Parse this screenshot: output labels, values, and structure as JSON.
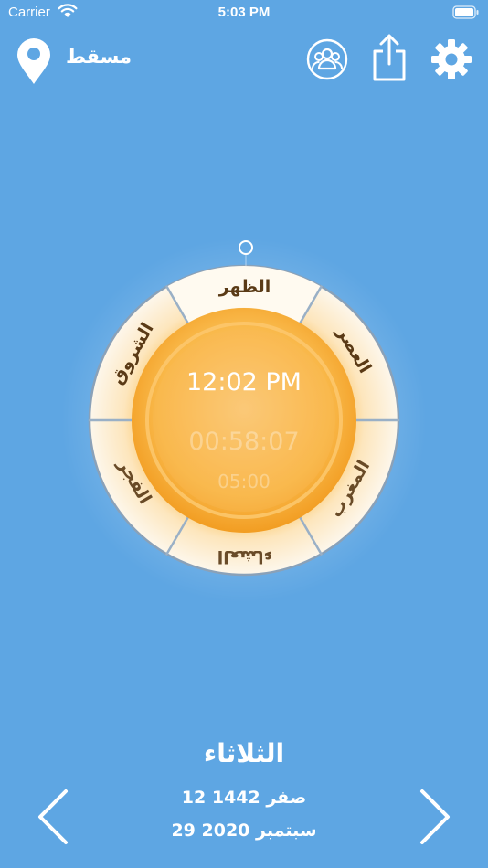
{
  "status_bar": {
    "carrier": "Carrier",
    "time": "5:03 PM"
  },
  "header": {
    "city": "مسقط",
    "icons": [
      "location-pin-icon",
      "people-icon",
      "share-icon",
      "gear-icon"
    ]
  },
  "prayer_wheel": {
    "segments": [
      {
        "name": "الظهر",
        "active": true
      },
      {
        "name": "العصر",
        "active": false
      },
      {
        "name": "المغرب",
        "active": false
      },
      {
        "name": "العشاء",
        "active": false
      },
      {
        "name": "الفجر",
        "active": false
      },
      {
        "name": "الشروق",
        "active": false
      }
    ],
    "current_time": "12:02 PM",
    "remaining": "00:58:07",
    "next_time": "05:00"
  },
  "footer": {
    "day": "الثلاثاء",
    "hijri_date": "12 صفر 1442",
    "gregorian_date": "29 سبتمبر 2020"
  },
  "colors": {
    "background": "#5ea6e3",
    "sun": "#f8b03c",
    "ring": "#fdf4e3",
    "label": "#5a3a16"
  }
}
